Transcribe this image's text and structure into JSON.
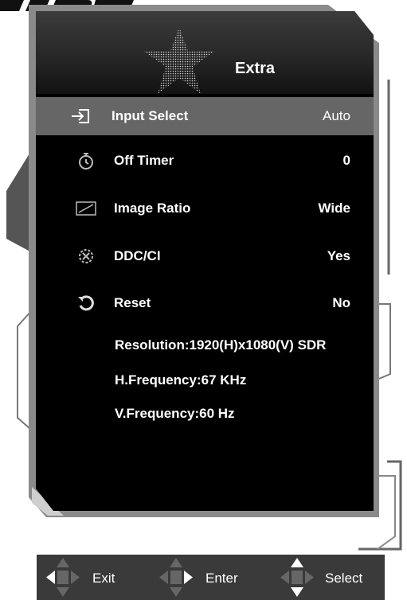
{
  "menu": {
    "title": "Extra",
    "items": [
      {
        "icon": "input-icon",
        "label": "Input Select",
        "value": "Auto",
        "selected": true
      },
      {
        "icon": "timer-icon",
        "label": "Off Timer",
        "value": "0"
      },
      {
        "icon": "aspect-ratio-icon",
        "label": "Image Ratio",
        "value": "Wide"
      },
      {
        "icon": "ddc-gear-icon",
        "label": "DDC/CI",
        "value": "Yes"
      },
      {
        "icon": "reset-icon",
        "label": "Reset",
        "value": "No"
      }
    ],
    "info": {
      "resolution": "Resolution:1920(H)x1080(V) SDR",
      "hfreq": "H.Frequency:67 KHz",
      "vfreq": "V.Frequency:60 Hz"
    }
  },
  "keys": {
    "exit": "Exit",
    "enter": "Enter",
    "select": "Select"
  },
  "colors": {
    "panel": "#000000",
    "selected_row": "#666666",
    "frame": "#8a8a8a",
    "keybar": "#3a3a3a"
  }
}
